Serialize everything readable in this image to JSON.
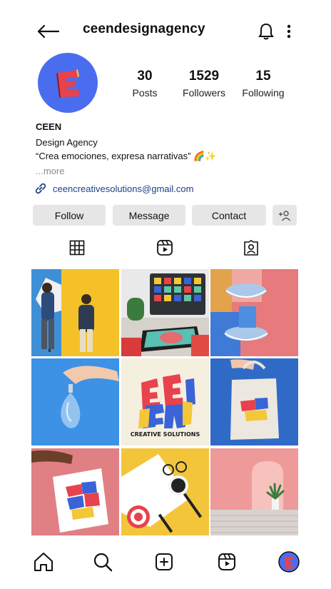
{
  "header": {
    "username": "ceendesignagency",
    "back_icon": "arrow-left-icon",
    "bell_icon": "bell-icon",
    "menu_icon": "more-vertical-icon"
  },
  "profile": {
    "stats": [
      {
        "value": "30",
        "label": "Posts"
      },
      {
        "value": "1529",
        "label": "Followers"
      },
      {
        "value": "15",
        "label": "Following"
      }
    ],
    "name": "CEEN",
    "category": "Design Agency",
    "bio": "“Crea emociones, expresa narrativas” 🌈✨",
    "more": "...more",
    "link": "ceencreativesolutions@gmail.com"
  },
  "actions": {
    "follow": "Follow",
    "message": "Message",
    "contact": "Contact"
  },
  "tabs": [
    "grid-icon",
    "reels-icon",
    "tagged-icon"
  ],
  "grid": {
    "logo_text": "CREATIVE SOLUTIONS"
  },
  "nav": [
    "home-icon",
    "search-icon",
    "create-icon",
    "reels-icon",
    "profile-avatar"
  ],
  "colors": {
    "link": "#20408a",
    "button_bg": "#e6e6e6",
    "avatar_bg": "#4a6df0",
    "brand_red": "#e8424c",
    "brand_yellow": "#f3c737",
    "brand_blue": "#3a63d8"
  }
}
